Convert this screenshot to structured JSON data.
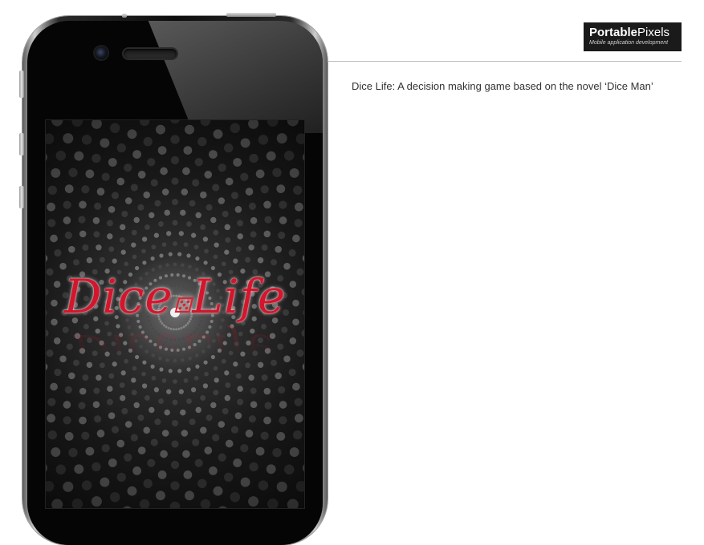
{
  "brand": {
    "name_bold": "Portable",
    "name_light": "Pixels",
    "tagline": "Mobile application development"
  },
  "caption": "Dice Life: A decision making game based on the novel ‘Dice Man’",
  "app_screen": {
    "logo_word_left": "Dice",
    "logo_word_right": "Life",
    "logo_text": "Dice•Life"
  },
  "colors": {
    "logo_red": "#d3162c",
    "brand_bg": "#1a1a1a",
    "divider": "#bdbdbd"
  }
}
